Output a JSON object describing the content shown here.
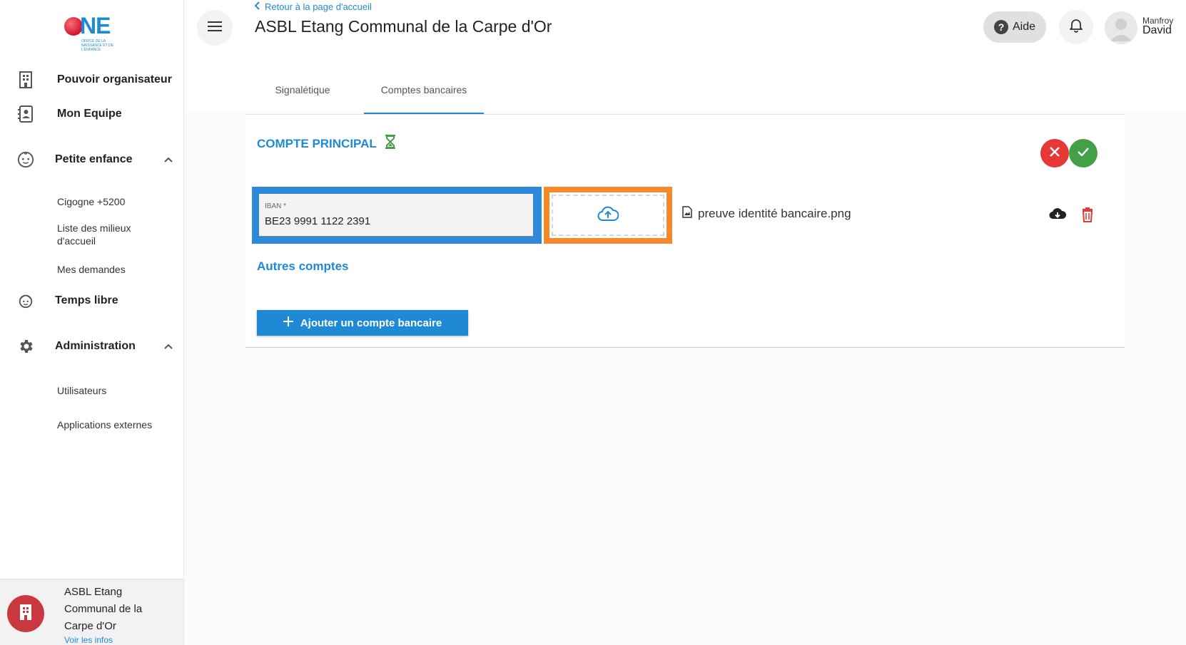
{
  "sidebar": {
    "logo_text": "NE",
    "logo_sub": "OFFICE DE LA NAISSANCE ET DE L'ENFANCE",
    "items": [
      {
        "label": "Pouvoir organisateur",
        "icon": "building-icon"
      },
      {
        "label": "Mon Equipe",
        "icon": "contact-card-icon"
      },
      {
        "label": "Petite enfance",
        "icon": "baby-face-icon"
      },
      {
        "label": "Temps libre",
        "icon": "child-face-icon"
      },
      {
        "label": "Administration",
        "icon": "gear-icon"
      }
    ],
    "petite_enfance_sub": [
      "Cigogne +5200",
      "Liste des milieux d'accueil",
      "Mes demandes"
    ],
    "admin_sub": [
      "Utilisateurs",
      "Applications externes"
    ],
    "org": {
      "name": "ASBL Etang Communal de la Carpe d'Or",
      "link": "Voir les infos"
    }
  },
  "header": {
    "back_link": "Retour à la page d'accueil",
    "title": "ASBL Etang Communal de la Carpe d'Or",
    "help_label": "Aide",
    "user_first": "Manfroy",
    "user_last": "David"
  },
  "tabs": [
    {
      "label": "Signalétique",
      "active": false
    },
    {
      "label": "Comptes bancaires",
      "active": true
    }
  ],
  "card": {
    "title": "COMPTE PRINCIPAL",
    "iban_label": "IBAN *",
    "iban_value": "BE23 9991 1122 2391",
    "file_name": "preuve identité bancaire.png",
    "other_accounts": "Autres comptes",
    "add_button": "Ajouter un compte bancaire"
  },
  "colors": {
    "accent": "#1e8ad6",
    "cancel": "#e53935",
    "confirm": "#43a047",
    "highlight_blue": "#2e8ad9",
    "highlight_orange": "#f68a2a",
    "delete": "#e53935"
  }
}
